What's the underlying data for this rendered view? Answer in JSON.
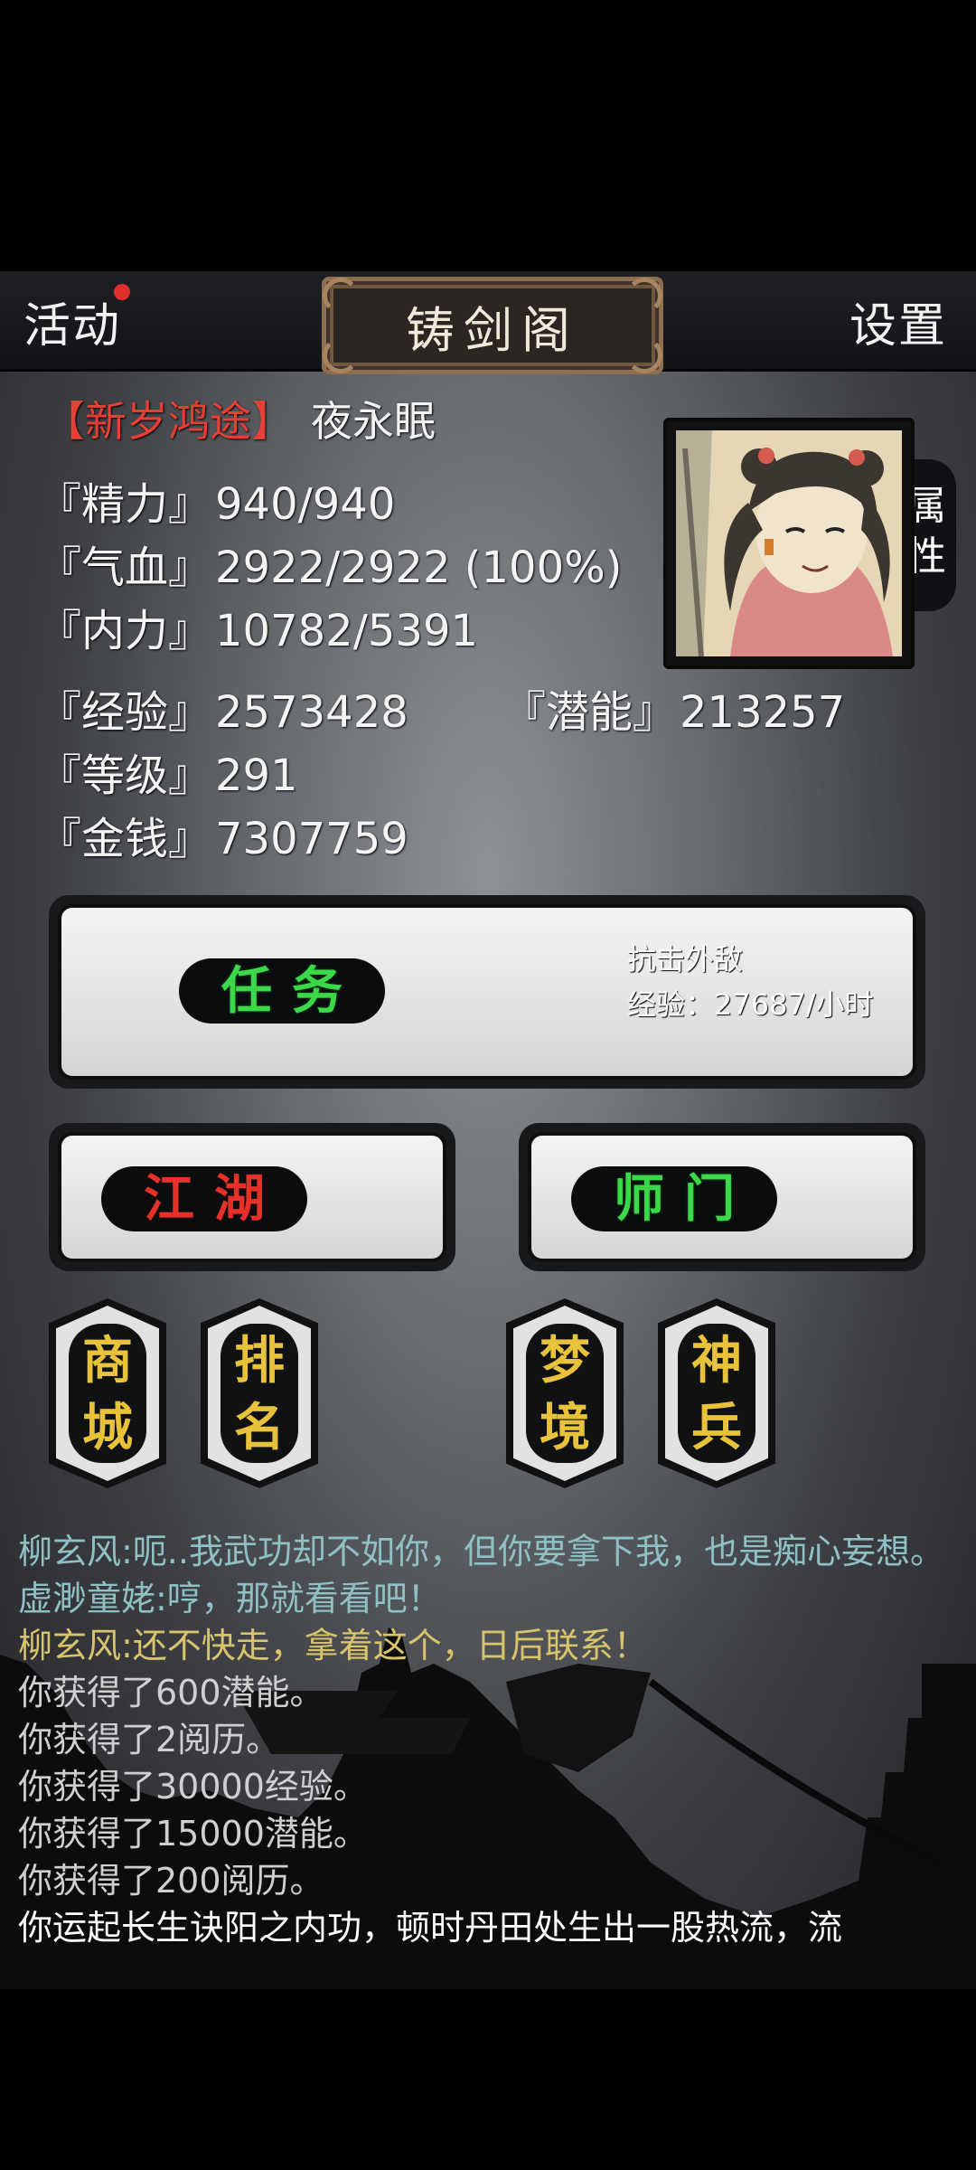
{
  "topbar": {
    "activity_label": "活动",
    "title": "铸剑阁",
    "settings_label": "设置"
  },
  "profile": {
    "event_tag": "【新岁鸿途】",
    "name": "夜永眠",
    "attr_tab": "属\n性",
    "stats": {
      "energy_label": "『精力』",
      "energy_value": "940/940",
      "hp_label": "『气血』",
      "hp_value": "2922/2922 (100%)",
      "mp_label": "『内力』",
      "mp_value": "10782/5391",
      "exp_label": "『经验』",
      "exp_value": "2573428",
      "potential_label": "『潜能』",
      "potential_value": "213257",
      "level_label": "『等级』",
      "level_value": "291",
      "money_label": "『金钱』",
      "money_value": "7307759"
    }
  },
  "buttons": {
    "task": "任务",
    "task_desc": "抗击外敌",
    "task_exp": "经验：27687/小时",
    "jianghu": "江湖",
    "shimen": "师门",
    "shop": "商城",
    "rank": "排名",
    "dream": "梦境",
    "weapon": "神兵"
  },
  "log": [
    {
      "text": "柳玄风:呃..我武功却不如你，但你要拿下我，也是痴心妄想。",
      "color": "teal"
    },
    {
      "text": "虚渺童姥:哼，那就看看吧！",
      "color": "teal"
    },
    {
      "text": "柳玄风:还不快走，拿着这个，日后联系！",
      "color": "gold"
    },
    {
      "text": "你获得了600潜能。",
      "color": "grey"
    },
    {
      "text": "你获得了2阅历。",
      "color": "grey"
    },
    {
      "text": "你获得了30000经验。",
      "color": "grey"
    },
    {
      "text": "你获得了15000潜能。",
      "color": "grey"
    },
    {
      "text": "你获得了200阅历。",
      "color": "grey"
    },
    {
      "text": "你运起长生诀阳之内功，顿时丹田处生出一股热流，流",
      "color": "white"
    }
  ]
}
